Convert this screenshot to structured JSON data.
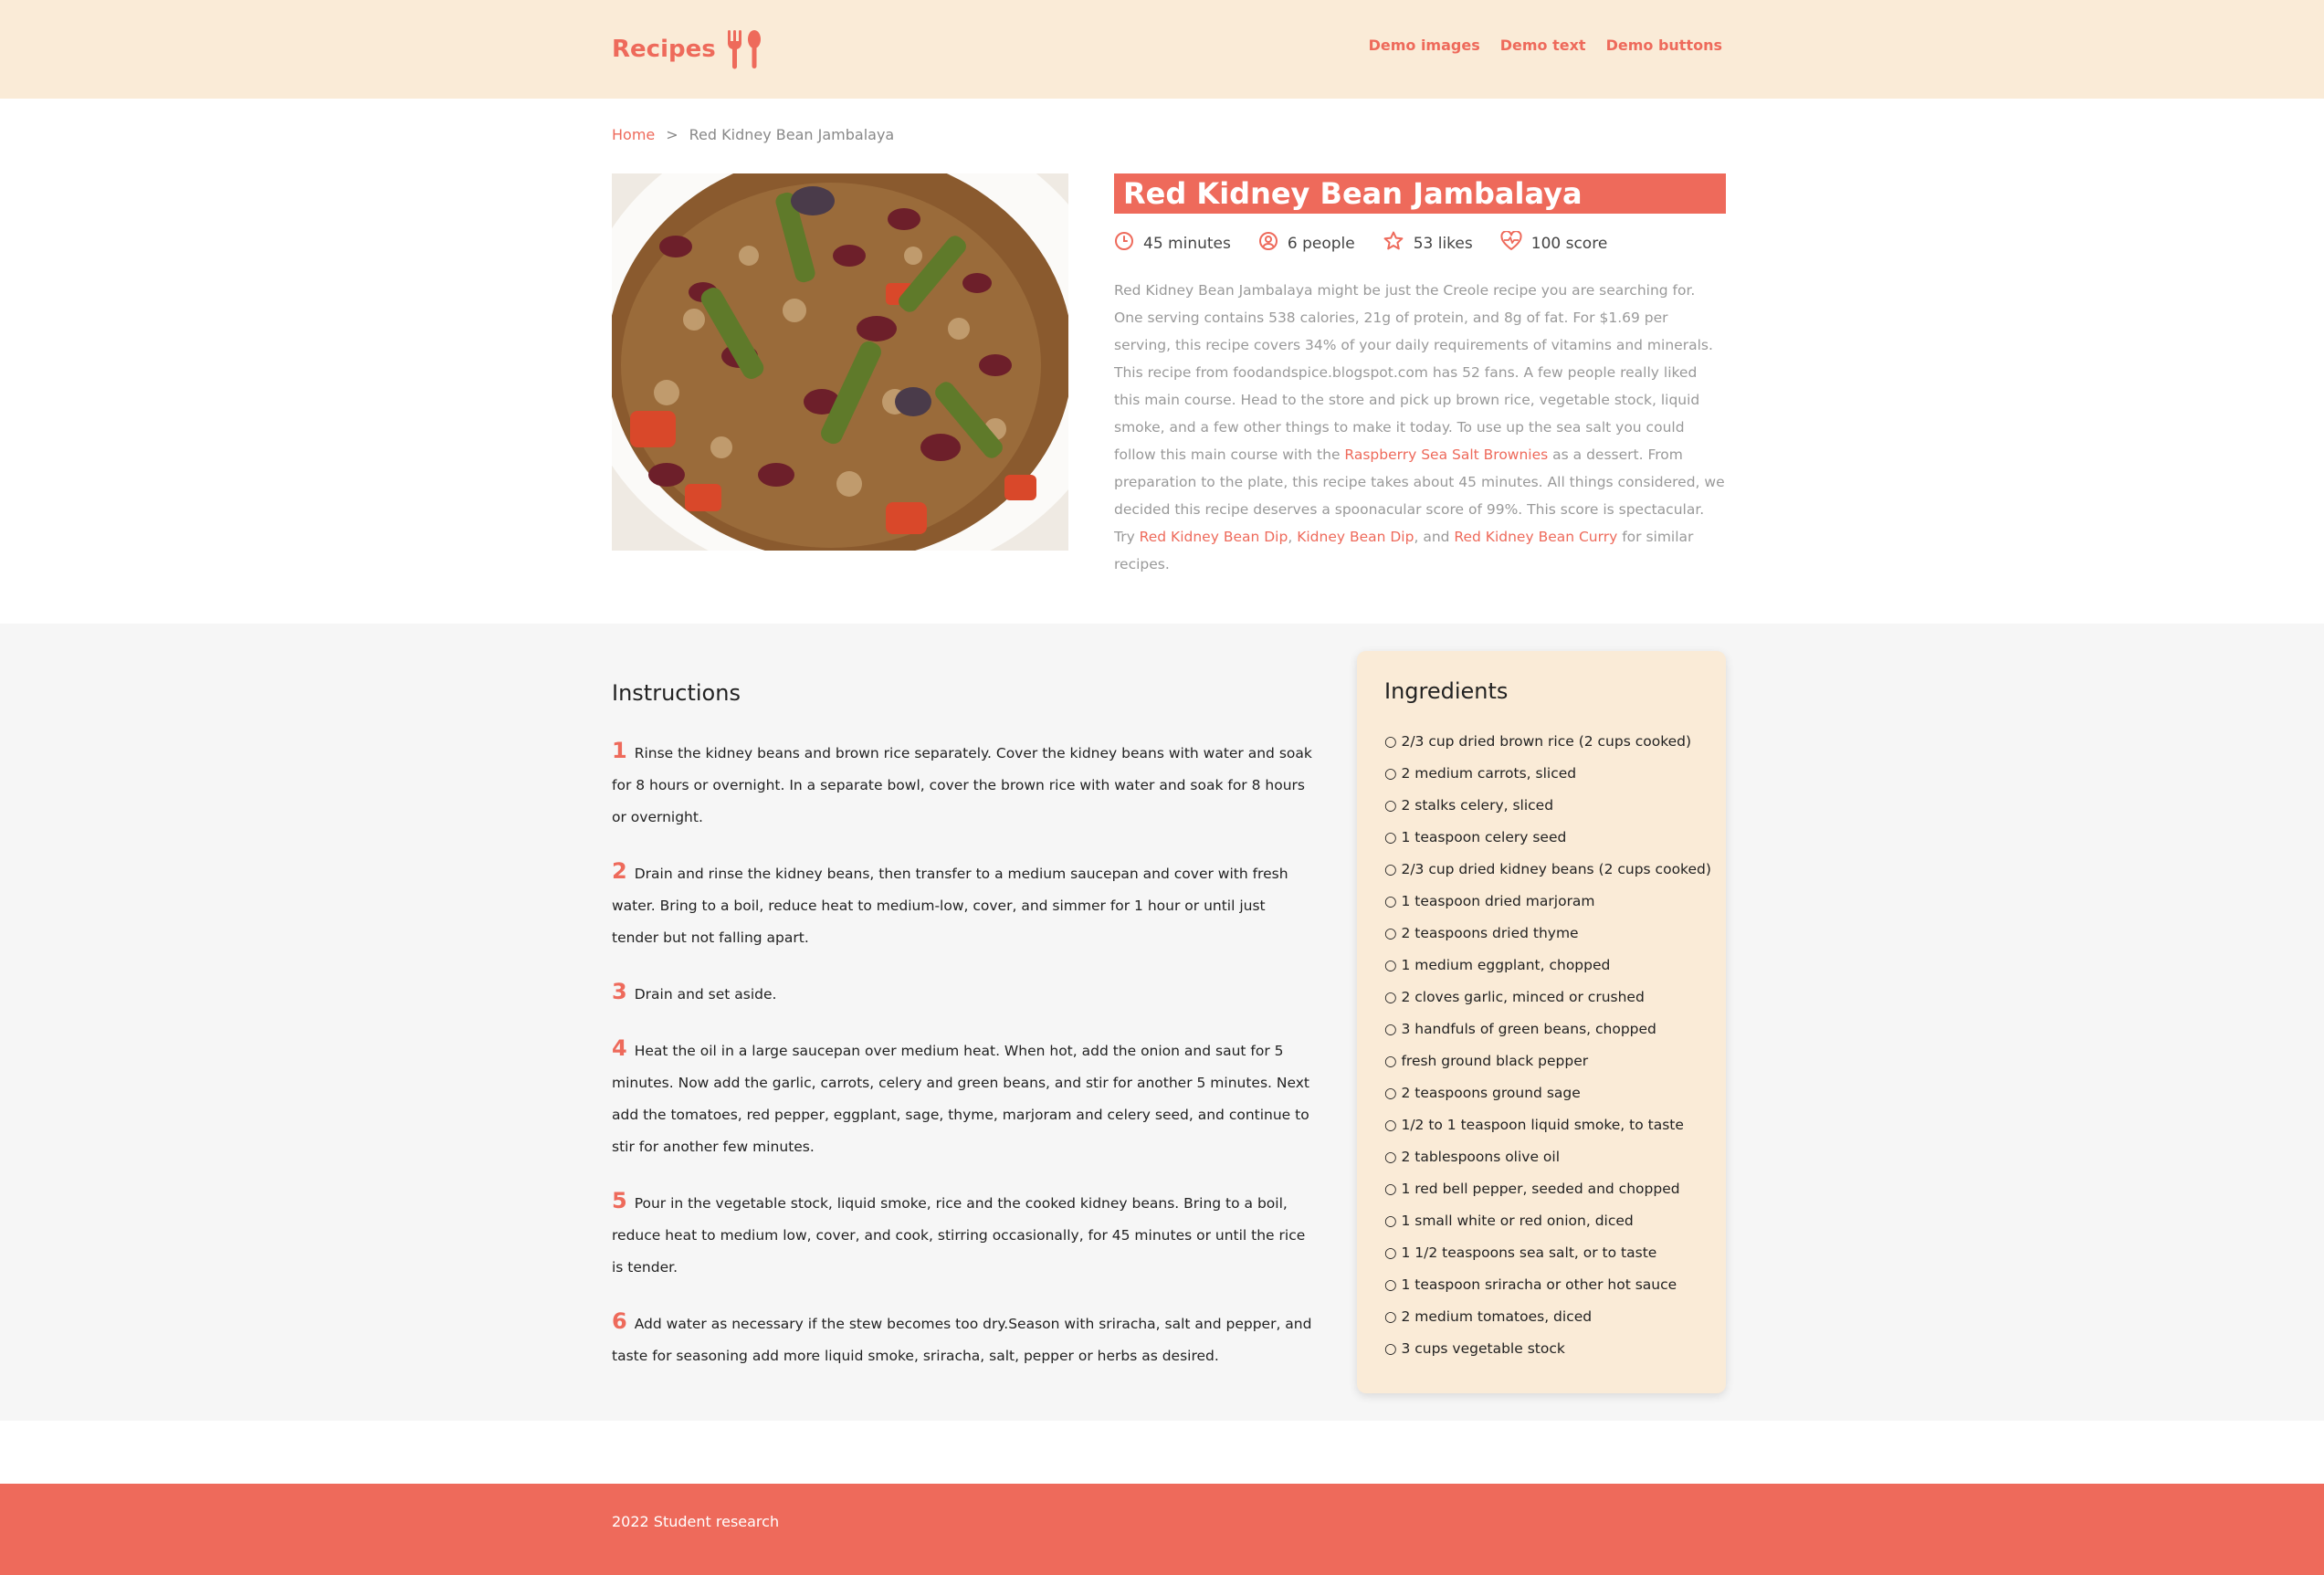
{
  "header": {
    "brand": "Recipes",
    "nav": [
      "Demo images",
      "Demo text",
      "Demo buttons"
    ]
  },
  "breadcrumb": {
    "home": "Home",
    "separator": ">",
    "current": "Red Kidney Bean Jambalaya"
  },
  "recipe": {
    "title": "Red Kidney Bean Jambalaya",
    "meta": {
      "time": "45 minutes",
      "servings": "6 people",
      "likes": "53 likes",
      "score": "100 score"
    },
    "summary": {
      "p1": "Red Kidney Bean Jambalaya might be just the Creole recipe you are searching for. One serving contains 538 calories, 21g of protein, and 8g of fat. For $1.69 per serving, this recipe covers 34% of your daily requirements of vitamins and minerals. This recipe from foodandspice.blogspot.com has 52 fans. A few people really liked this main course. Head to the store and pick up brown rice, vegetable stock, liquid smoke, and a few other things to make it today. To use up the sea salt you could follow this main course with the ",
      "link1": "Raspberry Sea Salt Brownies",
      "p2": " as a dessert. From preparation to the plate, this recipe takes about 45 minutes. All things considered, we decided this recipe deserves a spoonacular score of 99%. This score is spectacular. Try ",
      "link2": "Red Kidney Bean Dip",
      "sep1": ", ",
      "link3": "Kidney Bean Dip",
      "sep2": ", and ",
      "link4": "Red Kidney Bean Curry",
      "p3": " for similar recipes."
    }
  },
  "instructions": {
    "heading": "Instructions",
    "steps": [
      {
        "num": "1",
        "text": "Rinse the kidney beans and brown rice separately. Cover the kidney beans with water and soak for 8 hours or overnight. In a separate bowl, cover the brown rice with water and soak for 8 hours or overnight."
      },
      {
        "num": "2",
        "text": "Drain and rinse the kidney beans, then transfer to a medium saucepan and cover with fresh water. Bring to a boil, reduce heat to medium-low, cover, and simmer for 1 hour or until just tender but not falling apart."
      },
      {
        "num": "3",
        "text": "Drain and set aside."
      },
      {
        "num": "4",
        "text": "Heat the oil in a large saucepan over medium heat. When hot, add the onion and saut for 5 minutes. Now add the garlic, carrots, celery and green beans, and stir for another 5 minutes. Next add the tomatoes, red pepper, eggplant, sage, thyme, marjoram and celery seed, and continue to stir for another few minutes."
      },
      {
        "num": "5",
        "text": "Pour in the vegetable stock, liquid smoke, rice and the cooked kidney beans. Bring to a boil, reduce heat to medium low, cover, and cook, stirring occasionally, for 45 minutes or until the rice is tender."
      },
      {
        "num": "6",
        "text": "Add water as necessary if the stew becomes too dry.Season with sriracha, salt and pepper, and taste for seasoning add more liquid smoke, sriracha, salt, pepper or herbs as desired."
      }
    ]
  },
  "ingredients": {
    "heading": "Ingredients",
    "items": [
      "○ 2/3 cup dried brown rice (2 cups cooked)",
      "○ 2 medium carrots, sliced",
      "○ 2 stalks celery, sliced",
      "○ 1 teaspoon celery seed",
      "○ 2/3 cup dried kidney beans (2 cups cooked)",
      "○ 1 teaspoon dried marjoram",
      "○ 2 teaspoons dried thyme",
      "○ 1 medium eggplant, chopped",
      "○ 2 cloves garlic, minced or crushed",
      "○ 3 handfuls of green beans, chopped",
      "○ fresh ground black pepper",
      "○ 2 teaspoons ground sage",
      "○ 1/2 to 1 teaspoon liquid smoke, to taste",
      "○ 2 tablespoons olive oil",
      "○ 1 red bell pepper, seeded and chopped",
      "○ 1 small white or red onion, diced",
      "○ 1 1/2 teaspoons sea salt, or to taste",
      "○ 1 teaspoon sriracha or other hot sauce",
      "○ 2 medium tomatoes, diced",
      "○ 3 cups vegetable stock"
    ]
  },
  "footer": {
    "text": "2022 Student research"
  },
  "icons": {
    "brand": "fork-spoon-icon",
    "time": "clock-icon",
    "servings": "person-icon",
    "likes": "star-icon",
    "score": "heart-pulse-icon"
  },
  "colors": {
    "accent": "#ee6a5b",
    "header_bg": "#faebd7",
    "section_bg": "#f6f6f6"
  }
}
